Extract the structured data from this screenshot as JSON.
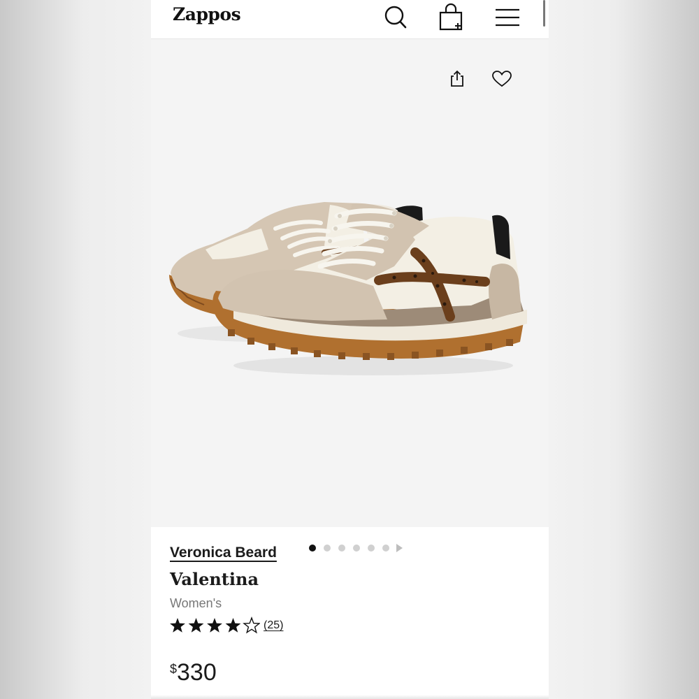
{
  "header": {
    "logo": "Zappos",
    "search_icon": "search-icon",
    "cart_icon": "shopping-bag-icon",
    "menu_icon": "hamburger-menu-icon"
  },
  "gallery": {
    "share_icon": "share-icon",
    "favorite_icon": "heart-icon",
    "image_alt": "product image of Valentina sneaker",
    "image_count": 6,
    "active_index": 0,
    "next_icon": "play-arrow-icon"
  },
  "product": {
    "brand": "Veronica Beard",
    "name": "Valentina",
    "gender": "Women's",
    "rating": 4,
    "rating_max": 5,
    "review_count": "(25)",
    "price_currency": "$",
    "price_amount": "330"
  },
  "colors": {
    "text": "#1b1b1b",
    "muted": "#777777",
    "gallery_bg": "#f4f4f4",
    "dot_active": "#111111",
    "dot_inactive": "#d0d0d0"
  }
}
